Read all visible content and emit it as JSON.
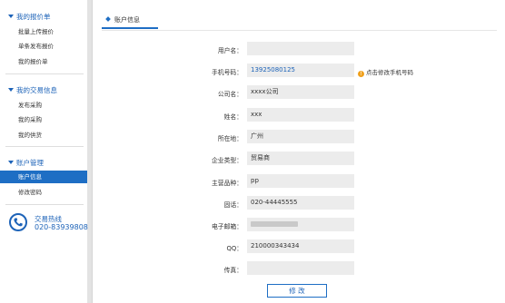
{
  "sidebar": {
    "sections": [
      {
        "title": "我的报价单",
        "items": [
          "批量上传报价",
          "单条发布报价",
          "我的报价单"
        ]
      },
      {
        "title": "我的交易信息",
        "items": [
          "发布采购",
          "我的采购",
          "我的供货"
        ]
      },
      {
        "title": "账户管理",
        "items": [
          "账户信息",
          "修改密码"
        ]
      }
    ],
    "hotline": {
      "label": "交易热线",
      "number": "020-83939808"
    }
  },
  "main": {
    "tab": "账户信息",
    "fields": [
      {
        "label": "用户名：",
        "value": ""
      },
      {
        "label": "手机号码：",
        "value": "13925080125"
      },
      {
        "label": "公司名：",
        "value": "xxxx公司"
      },
      {
        "label": "姓名：",
        "value": "xxx"
      },
      {
        "label": "所在地：",
        "value": "广州"
      },
      {
        "label": "企业类型：",
        "value": "贸易商"
      },
      {
        "label": "主营品种：",
        "value": "pp"
      },
      {
        "label": "固话：",
        "value": "020-44445555"
      },
      {
        "label": "电子邮箱：",
        "value": ""
      },
      {
        "label": "QQ：",
        "value": "210000343434"
      },
      {
        "label": "传真：",
        "value": ""
      }
    ],
    "phone_hint": "点击修改手机号码",
    "modify_button": "修 改"
  },
  "colors": {
    "accent": "#1e6ec4",
    "warn": "#f0a01c",
    "field_bg": "#ececec"
  },
  "icons": {
    "hotline": "phone-icon",
    "hint": "warning-icon",
    "tab": "diamond-icon"
  }
}
